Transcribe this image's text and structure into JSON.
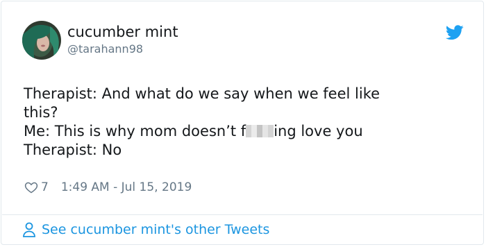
{
  "user": {
    "display_name": "cucumber mint",
    "handle": "@tarahann98",
    "avatar_icon": "profile-photo"
  },
  "tweet": {
    "line1": "Therapist: And what do we say when we feel like",
    "line2": "this?",
    "line3_start": "Me: This is why mom doesn’t f",
    "line3_end": "ing love you",
    "line4": "Therapist: No"
  },
  "meta": {
    "likes": "7",
    "timestamp": "1:49 AM - Jul 15, 2019"
  },
  "footer": {
    "link_label": "See cucumber mint's other Tweets"
  },
  "colors": {
    "brand": "#1da1f2",
    "link": "#1b95e0",
    "muted": "#657786"
  },
  "icons": {
    "logo": "twitter-bird-icon",
    "like": "heart-icon",
    "profile": "person-icon"
  }
}
